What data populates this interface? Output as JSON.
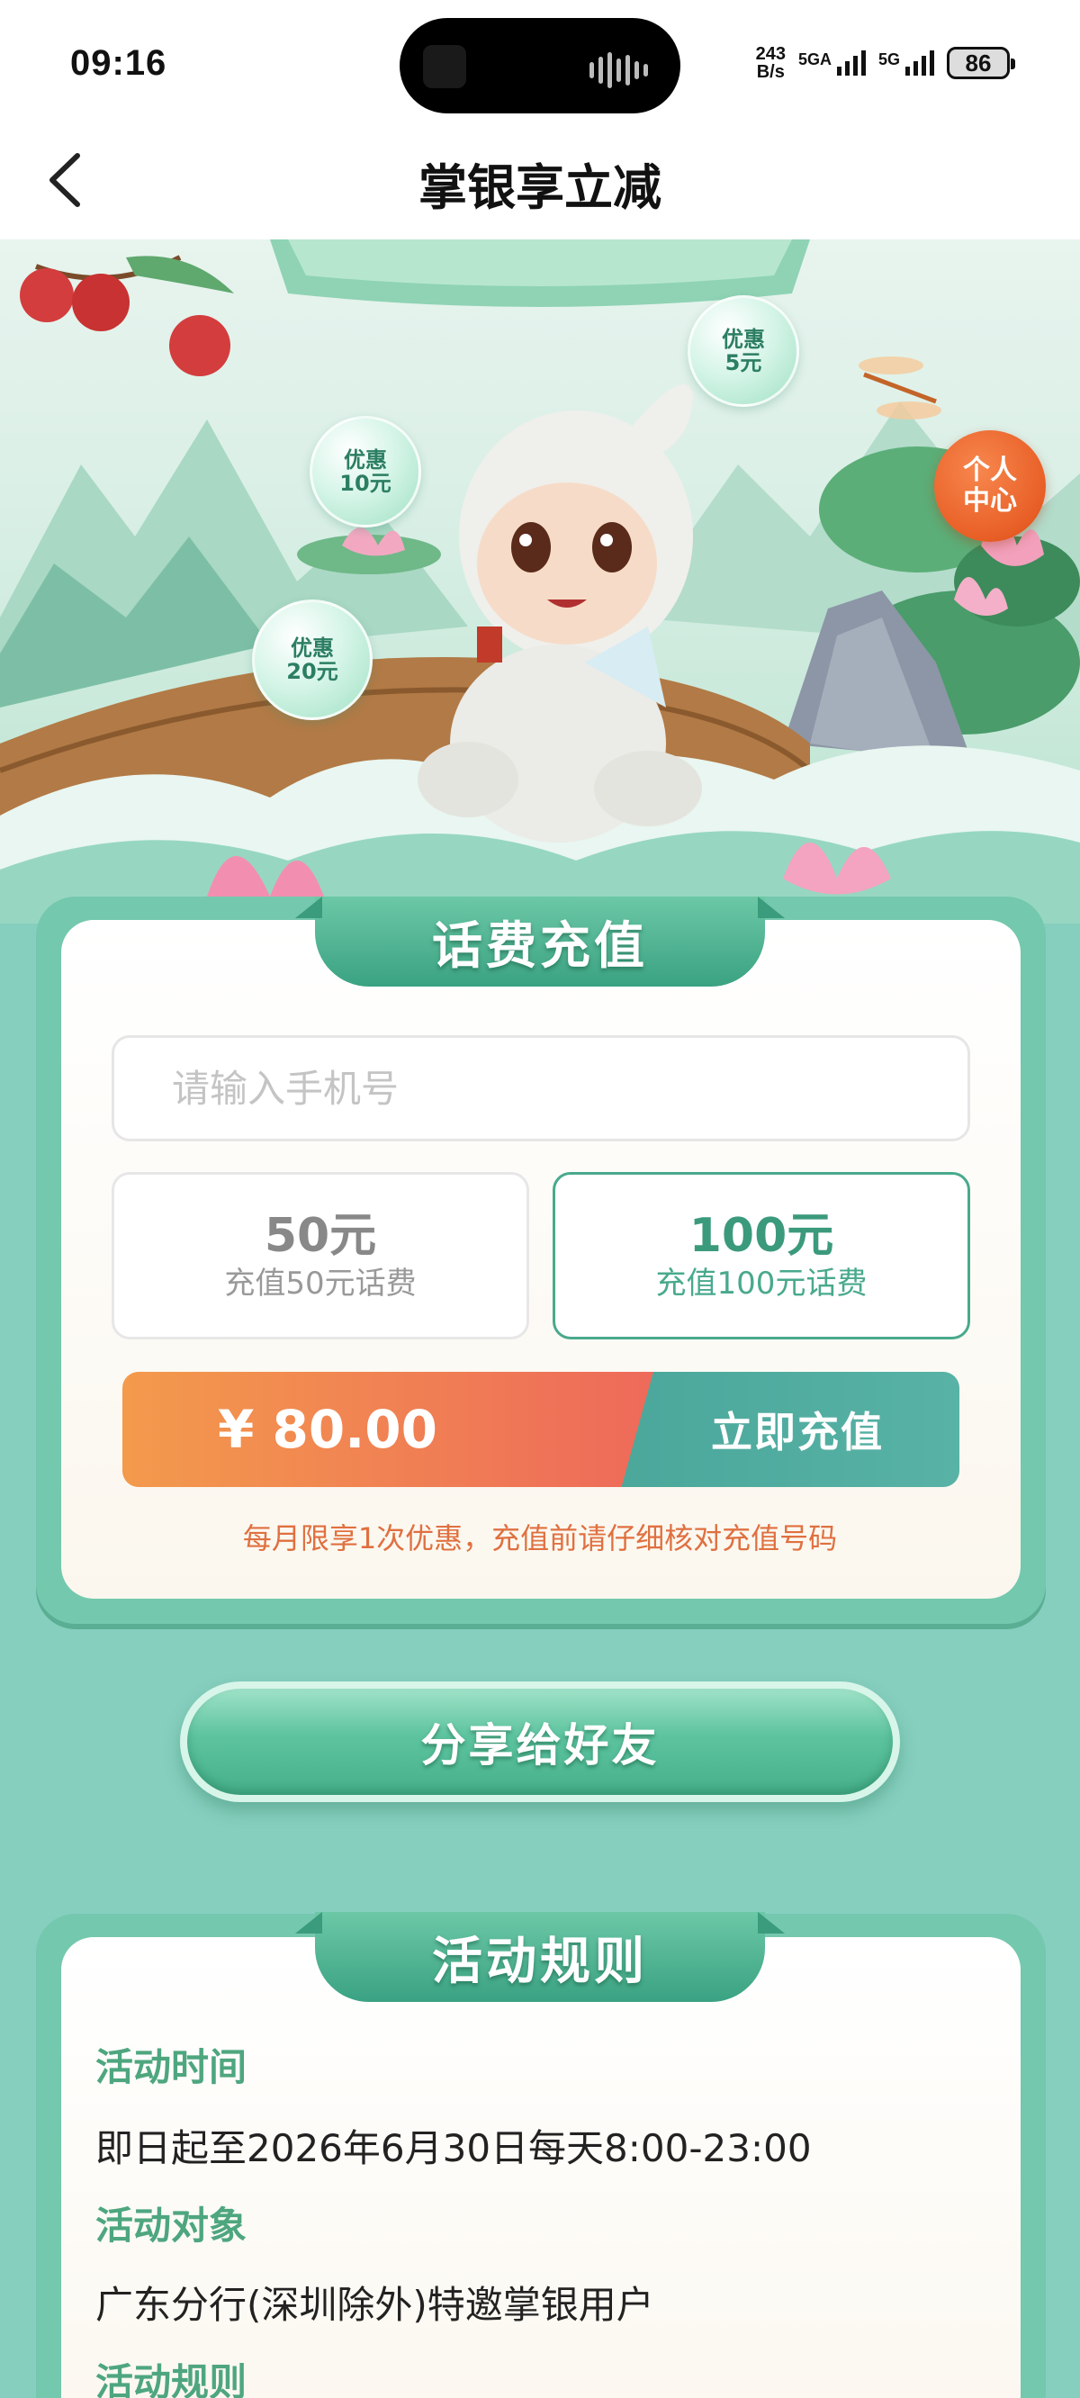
{
  "status_bar": {
    "time": "09:16",
    "net_speed_value": "243",
    "net_speed_unit": "B/s",
    "signal1_label": "5GA",
    "signal2_label": "5G",
    "battery": "86"
  },
  "nav": {
    "title": "掌银享立减"
  },
  "hero": {
    "bubbles": [
      {
        "line1": "优惠",
        "line2": "5元"
      },
      {
        "line1": "优惠",
        "line2": "10元"
      },
      {
        "line1": "优惠",
        "line2": "20元"
      }
    ],
    "personal_center_line1": "个人",
    "personal_center_line2": "中心"
  },
  "recharge": {
    "section_title": "话费充值",
    "phone_placeholder": "请输入手机号",
    "options": [
      {
        "amount": "50元",
        "desc": "充值50元话费",
        "selected": false
      },
      {
        "amount": "100元",
        "desc": "充值100元话费",
        "selected": true
      }
    ],
    "price": "¥ 80.00",
    "pay_button": "立即充值",
    "notice": "每月限享1次优惠，充值前请仔细核对充值号码"
  },
  "share_button": "分享给好友",
  "rules": {
    "section_title": "活动规则",
    "items": [
      {
        "heading": "活动时间",
        "text": "即日起至2026年6月30日每天8:00-23:00"
      },
      {
        "heading": "活动对象",
        "text": "广东分行(深圳除外)特邀掌银用户"
      },
      {
        "heading": "活动规则",
        "text": ""
      }
    ]
  },
  "colors": {
    "page_bg": "#86cfbf",
    "panel_border": "#74c8ad",
    "accent_green": "#49a98d",
    "orange_price": "#f39a4c",
    "notice_orange": "#e07040"
  }
}
